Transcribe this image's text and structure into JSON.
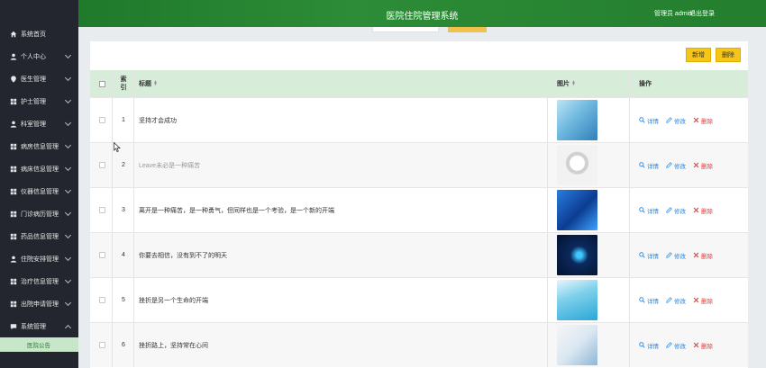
{
  "app": {
    "title": "医院住院管理系统"
  },
  "header": {
    "admin_label": "管理员 admin",
    "logout_label": "退出登录"
  },
  "sidebar": {
    "items": [
      {
        "label": "系统首页",
        "icon": "home-icon"
      },
      {
        "label": "个人中心",
        "icon": "user-icon"
      },
      {
        "label": "医生管理",
        "icon": "location-icon"
      },
      {
        "label": "护士管理",
        "icon": "grid-icon"
      },
      {
        "label": "科室管理",
        "icon": "user-icon"
      },
      {
        "label": "病房信息管理",
        "icon": "grid-icon"
      },
      {
        "label": "病床信息管理",
        "icon": "grid-icon"
      },
      {
        "label": "仪器信息管理",
        "icon": "grid-icon"
      },
      {
        "label": "门诊病历管理",
        "icon": "grid-icon"
      },
      {
        "label": "药品信息管理",
        "icon": "grid-icon"
      },
      {
        "label": "住院安排管理",
        "icon": "user-icon"
      },
      {
        "label": "治疗信息管理",
        "icon": "grid-icon"
      },
      {
        "label": "出院申请管理",
        "icon": "grid-icon"
      },
      {
        "label": "系统管理",
        "icon": "message-icon"
      }
    ],
    "sub_item": "医院公告"
  },
  "toolbar": {
    "add_label": "新增",
    "delete_label": "删除"
  },
  "table": {
    "headers": {
      "index": "索引",
      "title": "标题",
      "image": "图片",
      "ops": "操作"
    },
    "rows": [
      {
        "index": "1",
        "title": "坚持才会成功",
        "thumb": "t1"
      },
      {
        "index": "2",
        "title": "Leave未必是一种痛苦",
        "thumb": "t2"
      },
      {
        "index": "3",
        "title": "离开是一种痛苦，是一种勇气，但同样也是一个考验，是一个新的开端",
        "thumb": "t3"
      },
      {
        "index": "4",
        "title": "你要去相信，没有到不了的明天",
        "thumb": "t4"
      },
      {
        "index": "5",
        "title": "挫折是另一个生命的开端",
        "thumb": "t5"
      },
      {
        "index": "6",
        "title": "挫折路上，坚持常在心间",
        "thumb": "t6"
      }
    ],
    "ops": {
      "view": "详情",
      "edit": "修改",
      "remove": "删除"
    }
  },
  "colors": {
    "accent": "#2d8c37",
    "sidebar_bg": "#23262e",
    "button": "#f5c518",
    "danger": "#e53935",
    "link": "#1e88e5"
  }
}
